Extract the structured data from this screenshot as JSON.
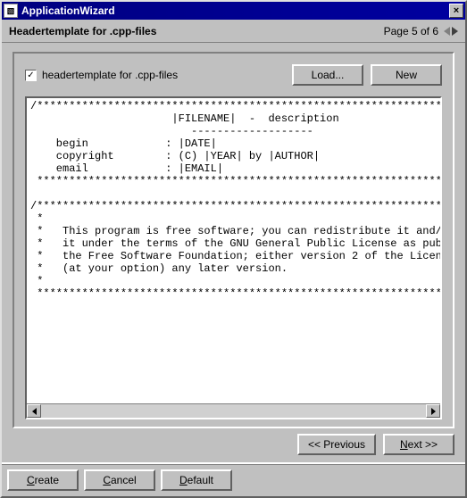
{
  "window": {
    "title": "ApplicationWizard"
  },
  "subheader": {
    "title": "Headertemplate for .cpp-files",
    "page": "Page 5 of 6"
  },
  "toprow": {
    "checkbox_checked": "✓",
    "label": "headertemplate for .cpp-files",
    "load": "Load...",
    "new": "New"
  },
  "template_text": "/***************************************************************\n                      |FILENAME|  -  description\n                         -------------------\n    begin            : |DATE|\n    copyright        : (C) |YEAR| by |AUTHOR|\n    email            : |EMAIL|\n ***************************************************************\n\n/***************************************************************\n *\n *   This program is free software; you can redistribute it and/o\n *   it under the terms of the GNU General Public License as publ\n *   the Free Software Foundation; either version 2 of the Licens\n *   (at your option) any later version.\n *\n ***************************************************************",
  "nav": {
    "prev": "<< Previous",
    "next_pre": "N",
    "next_post": "ext >>"
  },
  "footer": {
    "create_pre": "C",
    "create_post": "reate",
    "cancel_pre": "C",
    "cancel_post": "ancel",
    "default_pre": "D",
    "default_post": "efault"
  }
}
